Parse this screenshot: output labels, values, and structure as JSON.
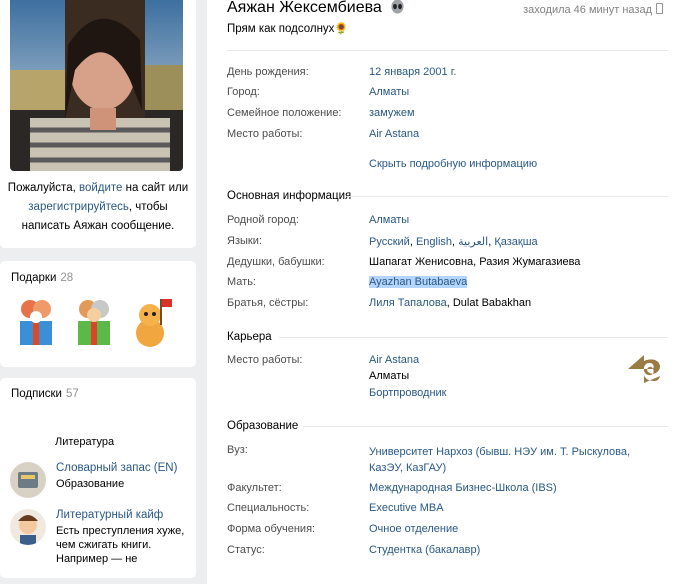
{
  "left": {
    "login_prefix": "Пожалуйста, ",
    "login_link": "войдите",
    "login_mid": " на сайт или ",
    "register_link": "зарегистрируйтесь",
    "login_suffix": ", чтобы написать Аяжан сообщение.",
    "gifts": {
      "title": "Подарки",
      "count": "28"
    },
    "subscriptions": {
      "title": "Подписки",
      "count": "57",
      "category": "Литература",
      "items": [
        {
          "name": "Словарный запас (EN)",
          "desc": "Образование"
        },
        {
          "name": "Литературный кайф",
          "desc": "Есть преступления хуже, чем сжигать книги. Например — не"
        }
      ]
    }
  },
  "profile": {
    "name": "Аяжан Жексембиева",
    "status": "Прям как подсолнух🌻",
    "last_seen": "заходила 46 минут назад"
  },
  "short_info": [
    {
      "label": "День рождения:",
      "value": "12 января 2001 г."
    },
    {
      "label": "Город:",
      "value": "Алматы"
    },
    {
      "label": "Семейное положение:",
      "value": "замужем"
    },
    {
      "label": "Место работы:",
      "value": "Air Astana"
    }
  ],
  "toggle_link": "Скрыть подробную информацию",
  "sections": {
    "basic": {
      "title": "Основная информация",
      "hometown": {
        "label": "Родной город:",
        "value": "Алматы"
      },
      "languages": {
        "label": "Языки:",
        "items": [
          "Русский",
          "English",
          "العربية",
          "Қазақша"
        ]
      },
      "grandparents": {
        "label": "Дедушки, бабушки:",
        "value": "Шапагат Женисовна, Разия Жумагазиева"
      },
      "mother": {
        "label": "Мать:",
        "value": "Ayazhan Butabaeva"
      },
      "siblings": {
        "label": "Братья, сёстры:",
        "link": "Лиля Тапалова",
        "plain": "Dulat Babakhan"
      }
    },
    "career": {
      "title": "Карьера",
      "label": "Место работы:",
      "company": "Air Astana",
      "city": "Алматы",
      "position": "Бортпроводник"
    },
    "education": {
      "title": "Образование",
      "rows": [
        {
          "label": "Вуз:",
          "value": "Университет Нархоз (бывш. НЭУ им. Т. Рыскулова, КазЭУ, КазГАУ)"
        },
        {
          "label": "Факультет:",
          "value": "Международная Бизнес-Школа (IBS)"
        },
        {
          "label": "Специальность:",
          "value": "Executive MBA"
        },
        {
          "label": "Форма обучения:",
          "value": "Очное отделение"
        },
        {
          "label": "Статус:",
          "value": "Студентка (бакалавр)"
        }
      ]
    }
  }
}
